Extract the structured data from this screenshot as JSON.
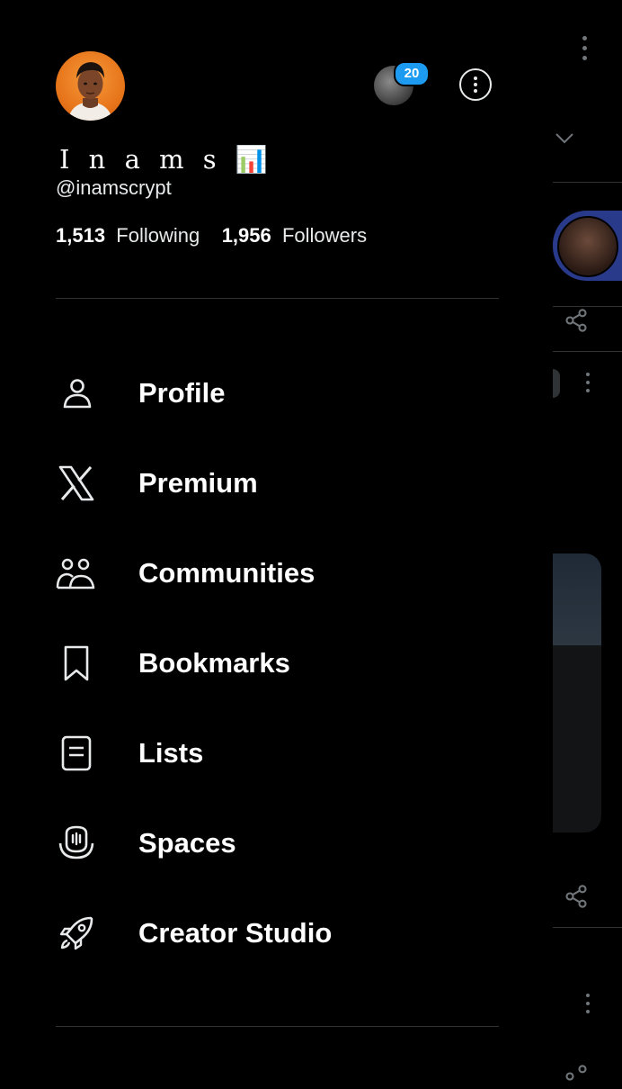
{
  "profile": {
    "display_name": "I n a m s",
    "name_emoji": "📊",
    "handle": "@inamscrypt",
    "following_count": "1,513",
    "following_label": "Following",
    "followers_count": "1,956",
    "followers_label": "Followers"
  },
  "account_switcher": {
    "notification_count": "20"
  },
  "menu": {
    "items": [
      {
        "label": "Profile",
        "icon": "person-icon"
      },
      {
        "label": "Premium",
        "icon": "x-logo-icon"
      },
      {
        "label": "Communities",
        "icon": "communities-icon"
      },
      {
        "label": "Bookmarks",
        "icon": "bookmark-icon"
      },
      {
        "label": "Lists",
        "icon": "lists-icon"
      },
      {
        "label": "Spaces",
        "icon": "spaces-icon"
      },
      {
        "label": "Creator Studio",
        "icon": "rocket-icon"
      }
    ]
  },
  "colors": {
    "background": "#000000",
    "text": "#e7e9ea",
    "divider": "#2f3336",
    "badge": "#1d9bf0"
  }
}
